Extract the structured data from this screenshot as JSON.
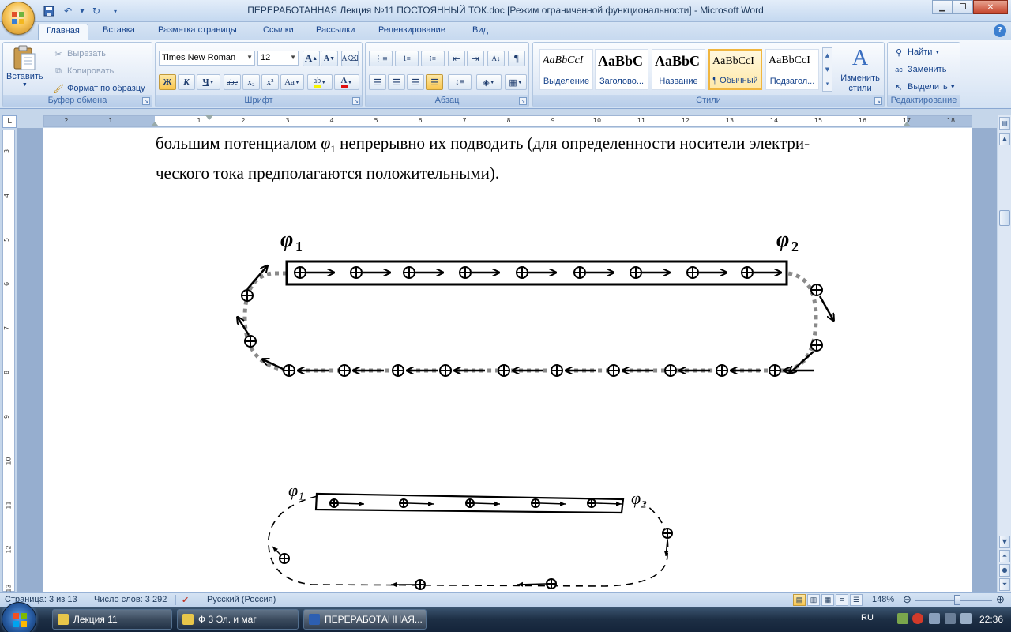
{
  "window": {
    "title": "ПЕРЕРАБОТАННАЯ Лекция №11 ПОСТОЯННЫЙ ТОК.doc [Режим ограниченной функциональности] - Microsoft Word"
  },
  "tabs": [
    "Главная",
    "Вставка",
    "Разметка страницы",
    "Ссылки",
    "Рассылки",
    "Рецензирование",
    "Вид"
  ],
  "clipboard": {
    "paste": "Вставить",
    "cut": "Вырезать",
    "copy": "Копировать",
    "format_painter": "Формат по образцу",
    "label": "Буфер обмена"
  },
  "font": {
    "family": "Times New Roman",
    "size": "12",
    "bold": "Ж",
    "italic": "К",
    "underline": "Ч",
    "strike": "abe",
    "subscript": "x₂",
    "superscript": "x²",
    "change_case": "Aa",
    "grow": "A",
    "shrink": "A",
    "label": "Шрифт"
  },
  "paragraph": {
    "label": "Абзац"
  },
  "styles": {
    "items": [
      {
        "sample": "AaBbCcI",
        "name": "Выделение"
      },
      {
        "sample": "AaBbC",
        "name": "Заголово..."
      },
      {
        "sample": "AaBbC",
        "name": "Название"
      },
      {
        "sample": "AaBbCcI",
        "name": "¶ Обычный"
      },
      {
        "sample": "AaBbCcI",
        "name": "Подзагол..."
      }
    ],
    "change": "Изменить стили",
    "label": "Стили"
  },
  "editing": {
    "find": "Найти",
    "replace": "Заменить",
    "select": "Выделить",
    "label": "Редактирование"
  },
  "ruler": {
    "left_numbers": [
      "2",
      "1"
    ],
    "right_numbers": [
      "1",
      "2",
      "3",
      "4",
      "5",
      "6",
      "7",
      "8",
      "9",
      "10",
      "11",
      "12",
      "13",
      "14",
      "15",
      "16",
      "17",
      "18"
    ],
    "vertical_numbers": [
      "3",
      "4",
      "5",
      "6",
      "7",
      "8",
      "9",
      "10",
      "11",
      "12",
      "13"
    ]
  },
  "document": {
    "line1_before": "большим потенциалом",
    "phi": "φ",
    "phi_sub": "1",
    "line1_after": "непрерывно их подводить (для определенности носители электри-",
    "line2": "ческого тока предполагаются положительными).",
    "fig1": {
      "phi1": "φ",
      "phi1_sub": "1",
      "phi2": "φ",
      "phi2_sub": "2"
    },
    "fig2": {
      "phi1": "φ₁",
      "phi2": "φ₂"
    }
  },
  "status": {
    "page": "Страница: 3 из 13",
    "words": "Число слов: 3 292",
    "language": "Русский (Россия)",
    "zoom": "148%",
    "zoom_level": 0.55
  },
  "taskbar": {
    "items": [
      "Лекция 11",
      "Ф 3 Эл. и маг",
      "ПЕРЕРАБОТАННАЯ..."
    ],
    "lang": "RU",
    "time": "22:36"
  },
  "colors": {
    "ribbon_text": "#15428b",
    "selected_style": "#f0b640",
    "taskbar": "#1d2f45"
  }
}
